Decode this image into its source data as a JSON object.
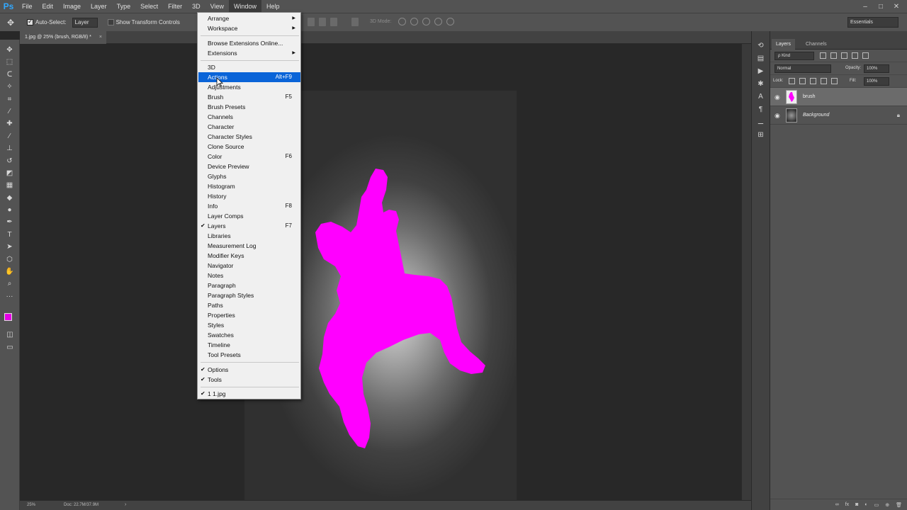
{
  "app": {
    "logo": "Ps"
  },
  "menubar": {
    "items": [
      {
        "label": "File"
      },
      {
        "label": "Edit"
      },
      {
        "label": "Image"
      },
      {
        "label": "Layer"
      },
      {
        "label": "Type"
      },
      {
        "label": "Select"
      },
      {
        "label": "Filter"
      },
      {
        "label": "3D"
      },
      {
        "label": "View"
      },
      {
        "label": "Window"
      },
      {
        "label": "Help"
      }
    ],
    "active": "Window"
  },
  "options": {
    "auto_select_label": "Auto-Select:",
    "auto_select_value": "Layer",
    "transform_label": "Show Transform Controls",
    "mode3d_label": "3D Mode:",
    "workspace": "Essentials"
  },
  "document": {
    "tab_label": "1.jpg @ 25% (brush, RGB/8) *",
    "close": "×"
  },
  "status": {
    "zoom": "25%",
    "doc_size": "Doc: 22.7M/37.9M",
    "arrow": "›"
  },
  "window_menu": {
    "items": [
      {
        "label": "Arrange",
        "submenu": true
      },
      {
        "label": "Workspace",
        "submenu": true
      },
      {
        "sep": true
      },
      {
        "label": "Browse Extensions Online..."
      },
      {
        "label": "Extensions",
        "submenu": true
      },
      {
        "sep": true
      },
      {
        "label": "3D"
      },
      {
        "label": "Actions",
        "shortcut": "Alt+F9",
        "highlighted": true
      },
      {
        "label": "Adjustments"
      },
      {
        "label": "Brush",
        "shortcut": "F5"
      },
      {
        "label": "Brush Presets"
      },
      {
        "label": "Channels"
      },
      {
        "label": "Character"
      },
      {
        "label": "Character Styles"
      },
      {
        "label": "Clone Source"
      },
      {
        "label": "Color",
        "shortcut": "F6"
      },
      {
        "label": "Device Preview"
      },
      {
        "label": "Glyphs"
      },
      {
        "label": "Histogram"
      },
      {
        "label": "History"
      },
      {
        "label": "Info",
        "shortcut": "F8"
      },
      {
        "label": "Layer Comps"
      },
      {
        "label": "Layers",
        "shortcut": "F7",
        "checked": true
      },
      {
        "label": "Libraries"
      },
      {
        "label": "Measurement Log"
      },
      {
        "label": "Modifier Keys"
      },
      {
        "label": "Navigator"
      },
      {
        "label": "Notes"
      },
      {
        "label": "Paragraph"
      },
      {
        "label": "Paragraph Styles"
      },
      {
        "label": "Paths"
      },
      {
        "label": "Properties"
      },
      {
        "label": "Styles"
      },
      {
        "label": "Swatches"
      },
      {
        "label": "Timeline"
      },
      {
        "label": "Tool Presets"
      },
      {
        "sep": true
      },
      {
        "label": "Options",
        "checked": true
      },
      {
        "label": "Tools",
        "checked": true
      },
      {
        "sep": true
      },
      {
        "label": "1 1.jpg",
        "checked": true
      }
    ]
  },
  "layers_panel": {
    "tabs": [
      {
        "label": "Layers",
        "active": true
      },
      {
        "label": "Channels"
      }
    ],
    "kind": "ρ Kind",
    "blend_mode": "Normal",
    "opacity_label": "Opacity:",
    "opacity": "100%",
    "lock_label": "Lock:",
    "fill_label": "Fill:",
    "fill": "100%",
    "layers": [
      {
        "name": "brush",
        "selected": true
      },
      {
        "name": "Background",
        "locked": true
      }
    ]
  },
  "colors": {
    "foreground": "#e600e6",
    "background": "#ffffff",
    "highlight": "#0a64d8",
    "silhouette": "#ff00ff"
  },
  "icons": {
    "eye": "◉",
    "lock": "🔒",
    "check": "✔",
    "submenu": "▶",
    "chevron": "▾"
  }
}
